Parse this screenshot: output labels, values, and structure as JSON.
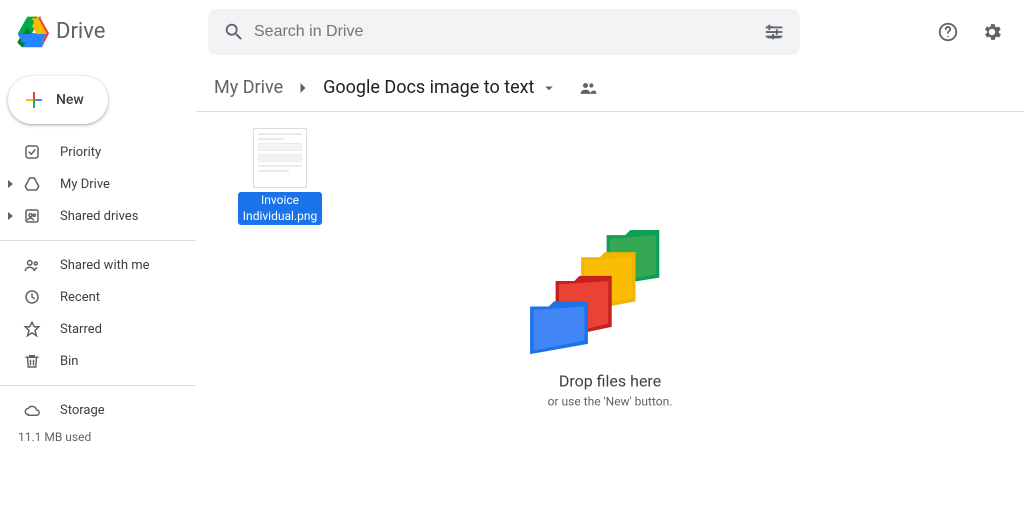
{
  "header": {
    "app_name": "Drive",
    "search_placeholder": "Search in Drive"
  },
  "sidebar": {
    "new_button": "New",
    "items": [
      {
        "label": "Priority"
      },
      {
        "label": "My Drive"
      },
      {
        "label": "Shared drives"
      },
      {
        "label": "Shared with me"
      },
      {
        "label": "Recent"
      },
      {
        "label": "Starred"
      },
      {
        "label": "Bin"
      },
      {
        "label": "Storage"
      }
    ],
    "storage_used": "11.1 MB used"
  },
  "breadcrumb": {
    "root": "My Drive",
    "current": "Google Docs image to text"
  },
  "files": [
    {
      "name": "Invoice Individual.png"
    }
  ],
  "drop": {
    "title": "Drop files here",
    "subtitle": "or use the 'New' button."
  }
}
